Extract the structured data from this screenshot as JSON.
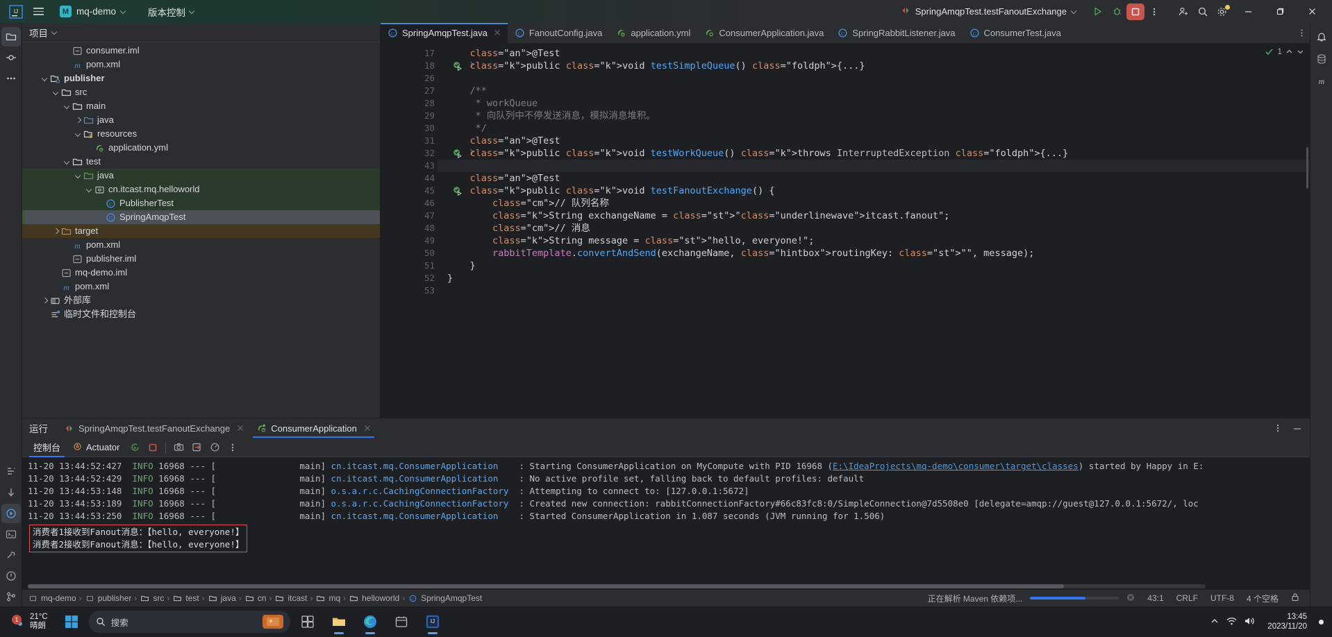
{
  "titlebar": {
    "menu_icon": "hamburger-menu-icon",
    "logo": "intellij-idea-logo",
    "project_badge": "M",
    "project_name": "mq-demo",
    "vcs_label": "版本控制",
    "run_config": "SpringAmqpTest.testFanoutExchange",
    "actions": [
      "run-button",
      "debug-button",
      "stop-button",
      "more-actions-button",
      "share-button",
      "search-everywhere-button",
      "settings-button"
    ],
    "window_controls": [
      "minimize",
      "maximize",
      "close"
    ]
  },
  "left_rail": {
    "items": [
      {
        "name": "project-tool-window",
        "icon": "folder-icon",
        "active": true
      },
      {
        "name": "commit-tool-window",
        "icon": "commit-icon",
        "active": false
      },
      {
        "name": "more-tool-windows",
        "icon": "ellipsis-icon",
        "active": false
      },
      {
        "name": "structure-tool-window",
        "icon": "structure-icon",
        "active": false
      },
      {
        "name": "bookmarks-tool-window",
        "icon": "arrow-down-icon",
        "active": false
      },
      {
        "name": "run-tool-window",
        "icon": "run-icon",
        "active": true
      },
      {
        "name": "terminal-tool-window",
        "icon": "terminal-icon",
        "active": false
      },
      {
        "name": "build-tool-window",
        "icon": "build-icon",
        "active": false
      },
      {
        "name": "problems-tool-window",
        "icon": "warning-icon",
        "active": false
      },
      {
        "name": "git-tool-window",
        "icon": "git-icon",
        "active": false
      }
    ]
  },
  "right_rail": {
    "items": [
      {
        "name": "notifications-tool-window",
        "icon": "bell-icon"
      },
      {
        "name": "database-tool-window",
        "icon": "database-icon"
      },
      {
        "name": "maven-tool-window",
        "icon": "maven-m-icon"
      }
    ]
  },
  "project_panel": {
    "title": "项目",
    "tree": [
      {
        "indent": 3,
        "arrow": "none",
        "icon": "iml-file-icon",
        "label": "consumer.iml",
        "bold": false,
        "state": "none"
      },
      {
        "indent": 3,
        "arrow": "none",
        "icon": "maven-m-icon",
        "label": "pom.xml",
        "bold": false,
        "state": "none"
      },
      {
        "indent": 1,
        "arrow": "down",
        "icon": "module-folder-icon",
        "label": "publisher",
        "bold": true,
        "state": "none"
      },
      {
        "indent": 2,
        "arrow": "down",
        "icon": "folder-icon",
        "label": "src",
        "bold": false,
        "state": "none"
      },
      {
        "indent": 3,
        "arrow": "down",
        "icon": "folder-icon",
        "label": "main",
        "bold": false,
        "state": "none"
      },
      {
        "indent": 4,
        "arrow": "right",
        "icon": "source-folder-icon",
        "label": "java",
        "bold": false,
        "state": "none"
      },
      {
        "indent": 4,
        "arrow": "down",
        "icon": "resource-folder-icon",
        "label": "resources",
        "bold": false,
        "state": "none"
      },
      {
        "indent": 5,
        "arrow": "none",
        "icon": "spring-yaml-icon",
        "label": "application.yml",
        "bold": false,
        "state": "none"
      },
      {
        "indent": 3,
        "arrow": "down",
        "icon": "folder-icon",
        "label": "test",
        "bold": false,
        "state": "none"
      },
      {
        "indent": 4,
        "arrow": "down",
        "icon": "test-source-folder-icon",
        "label": "java",
        "bold": false,
        "state": "green"
      },
      {
        "indent": 5,
        "arrow": "down",
        "icon": "package-icon",
        "label": "cn.itcast.mq.helloworld",
        "bold": false,
        "state": "green"
      },
      {
        "indent": 6,
        "arrow": "none",
        "icon": "java-class-icon",
        "label": "PublisherTest",
        "bold": false,
        "state": "green"
      },
      {
        "indent": 6,
        "arrow": "none",
        "icon": "java-class-icon",
        "label": "SpringAmqpTest",
        "bold": false,
        "state": "selected"
      },
      {
        "indent": 2,
        "arrow": "right",
        "icon": "excluded-folder-icon",
        "label": "target",
        "bold": false,
        "state": "brown"
      },
      {
        "indent": 3,
        "arrow": "none",
        "icon": "maven-m-icon",
        "label": "pom.xml",
        "bold": false,
        "state": "none"
      },
      {
        "indent": 3,
        "arrow": "none",
        "icon": "iml-file-icon",
        "label": "publisher.iml",
        "bold": false,
        "state": "none"
      },
      {
        "indent": 2,
        "arrow": "none",
        "icon": "iml-file-icon",
        "label": "mq-demo.iml",
        "bold": false,
        "state": "none"
      },
      {
        "indent": 2,
        "arrow": "none",
        "icon": "maven-m-icon",
        "label": "pom.xml",
        "bold": false,
        "state": "none"
      },
      {
        "indent": 1,
        "arrow": "right",
        "icon": "library-icon",
        "label": "外部库",
        "bold": false,
        "state": "none"
      },
      {
        "indent": 1,
        "arrow": "none",
        "icon": "scratches-icon",
        "label": "临时文件和控制台",
        "bold": false,
        "state": "none"
      }
    ]
  },
  "editor": {
    "tabs": [
      {
        "label": "SpringAmqpTest.java",
        "icon": "java-class-icon",
        "active": true,
        "closable": true
      },
      {
        "label": "FanoutConfig.java",
        "icon": "java-class-icon",
        "active": false,
        "closable": false
      },
      {
        "label": "application.yml",
        "icon": "spring-yaml-icon",
        "active": false,
        "closable": false
      },
      {
        "label": "ConsumerApplication.java",
        "icon": "spring-class-icon",
        "active": false,
        "closable": false
      },
      {
        "label": "SpringRabbitListener.java",
        "icon": "java-class-icon",
        "active": false,
        "closable": false
      },
      {
        "label": "ConsumerTest.java",
        "icon": "java-class-icon",
        "active": false,
        "closable": false
      }
    ],
    "inspection_count": "1",
    "lines": [
      {
        "num": "17",
        "gutter": "none",
        "fold": false,
        "highlight": false
      },
      {
        "num": "18",
        "gutter": "run-test",
        "fold": true,
        "highlight": false
      },
      {
        "num": "26",
        "gutter": "none",
        "fold": false,
        "highlight": false
      },
      {
        "num": "27",
        "gutter": "none",
        "fold": false,
        "highlight": false
      },
      {
        "num": "28",
        "gutter": "none",
        "fold": false,
        "highlight": false
      },
      {
        "num": "29",
        "gutter": "none",
        "fold": false,
        "highlight": false
      },
      {
        "num": "30",
        "gutter": "none",
        "fold": false,
        "highlight": false
      },
      {
        "num": "31",
        "gutter": "none",
        "fold": false,
        "highlight": false
      },
      {
        "num": "32",
        "gutter": "run-test",
        "fold": true,
        "highlight": false
      },
      {
        "num": "43",
        "gutter": "none",
        "fold": false,
        "highlight": true
      },
      {
        "num": "44",
        "gutter": "none",
        "fold": false,
        "highlight": false
      },
      {
        "num": "45",
        "gutter": "run-test",
        "fold": false,
        "highlight": false
      },
      {
        "num": "46",
        "gutter": "none",
        "fold": false,
        "highlight": false
      },
      {
        "num": "47",
        "gutter": "none",
        "fold": false,
        "highlight": false
      },
      {
        "num": "48",
        "gutter": "none",
        "fold": false,
        "highlight": false
      },
      {
        "num": "49",
        "gutter": "none",
        "fold": false,
        "highlight": false
      },
      {
        "num": "50",
        "gutter": "none",
        "fold": false,
        "highlight": false
      },
      {
        "num": "51",
        "gutter": "none",
        "fold": false,
        "highlight": false
      },
      {
        "num": "52",
        "gutter": "none",
        "fold": false,
        "highlight": false
      },
      {
        "num": "53",
        "gutter": "none",
        "fold": false,
        "highlight": false
      }
    ],
    "code_text": [
      "    @Test",
      "    public void testSimpleQueue() {...}",
      "",
      "    /**",
      "     * workQueue",
      "     * 向队列中不停发送消息，模拟消息堆积。",
      "     */",
      "    @Test",
      "    public void testWorkQueue() throws InterruptedException {...}",
      "",
      "    @Test",
      "    public void testFanoutExchange() {",
      "        // 队列名称",
      "        String exchangeName = \"itcast.fanout\";",
      "        // 消息",
      "        String message = \"hello, everyone!\";",
      "        rabbitTemplate.convertAndSend(exchangeName, routingKey: \"\", message);",
      "    }",
      "}",
      ""
    ],
    "inlay_hint": "routingKey:"
  },
  "bottom_window": {
    "title": "运行",
    "tabs": [
      {
        "label": "SpringAmqpTest.testFanoutExchange",
        "icon": "rerun-failed-icon",
        "active": false
      },
      {
        "label": "ConsumerApplication",
        "icon": "spring-boot-icon",
        "active": true
      }
    ],
    "subtabs": [
      {
        "label": "控制台",
        "active": true
      },
      {
        "label": "Actuator",
        "active": false,
        "icon": "actuator-icon"
      }
    ],
    "sub_actions": [
      "rerun-icon",
      "stop-icon",
      "camera-icon",
      "export-icon",
      "dashboard-icon",
      "more-icon"
    ],
    "head_actions": [
      "settings-icon",
      "minimize-icon"
    ],
    "console_lines": [
      {
        "time": "11-20 13:44:52:427",
        "level": "INFO",
        "pid": "16968",
        "dashes": "--- [",
        "thread": "main]",
        "logger": "cn.itcast.mq.ConsumerApplication",
        "sep": ": ",
        "message": "Starting ConsumerApplication on MyCompute with PID 16968 (",
        "link": "E:\\IdeaProjects\\mq-demo\\consumer\\target\\classes",
        "tail": ") started by Happy in E:"
      },
      {
        "time": "11-20 13:44:52:429",
        "level": "INFO",
        "pid": "16968",
        "dashes": "--- [",
        "thread": "main]",
        "logger": "cn.itcast.mq.ConsumerApplication",
        "sep": ": ",
        "message": "No active profile set, falling back to default profiles: default",
        "link": "",
        "tail": ""
      },
      {
        "time": "11-20 13:44:53:148",
        "level": "INFO",
        "pid": "16968",
        "dashes": "--- [",
        "thread": "main]",
        "logger": "o.s.a.r.c.CachingConnectionFactory",
        "sep": ": ",
        "message": "Attempting to connect to: [127.0.0.1:5672]",
        "link": "",
        "tail": ""
      },
      {
        "time": "11-20 13:44:53:189",
        "level": "INFO",
        "pid": "16968",
        "dashes": "--- [",
        "thread": "main]",
        "logger": "o.s.a.r.c.CachingConnectionFactory",
        "sep": ": ",
        "message": "Created new connection: rabbitConnectionFactory#66c83fc8:0/SimpleConnection@7d5508e0 [delegate=amqp://guest@127.0.0.1:5672/, loc",
        "link": "",
        "tail": ""
      },
      {
        "time": "11-20 13:44:53:250",
        "level": "INFO",
        "pid": "16968",
        "dashes": "--- [",
        "thread": "main]",
        "logger": "cn.itcast.mq.ConsumerApplication",
        "sep": ": ",
        "message": "Started ConsumerApplication in 1.087 seconds (JVM running for 1.506)",
        "link": "",
        "tail": ""
      }
    ],
    "highlighted_output": [
      "消费者1接收到Fanout消息：【hello, everyone!】",
      "消费者2接收到Fanout消息：【hello, everyone!】"
    ],
    "highlight_color": "#e05252"
  },
  "status_bar": {
    "breadcrumbs": [
      "mq-demo",
      "publisher",
      "src",
      "test",
      "java",
      "cn",
      "itcast",
      "mq",
      "helloworld",
      "SpringAmqpTest"
    ],
    "breadcrumb_icons": [
      "module-icon",
      "module-icon",
      "folder-icon",
      "folder-icon",
      "folder-icon",
      "folder-icon",
      "folder-icon",
      "folder-icon",
      "folder-icon",
      "java-class-icon"
    ],
    "progress_text": "正在解析 Maven 依赖项...",
    "progress_percent": 62,
    "caret_position": "43:1",
    "line_separator": "CRLF",
    "encoding": "UTF-8",
    "indent": "4 个空格",
    "cancel_icon": "cancel-icon"
  },
  "taskbar": {
    "weather_temp": "21°C",
    "weather_desc": "晴朗",
    "weather_badge": "1",
    "search_placeholder": "搜索",
    "apps": [
      {
        "name": "taskbar-start-button",
        "icon": "windows-logo",
        "running": false
      },
      {
        "name": "taskbar-widgets",
        "icon": "widgets-icon",
        "running": false
      },
      {
        "name": "taskbar-file-explorer",
        "icon": "folder-icon",
        "running": true
      },
      {
        "name": "taskbar-edge",
        "icon": "edge-icon",
        "running": true
      },
      {
        "name": "taskbar-store",
        "icon": "store-icon",
        "running": false
      },
      {
        "name": "taskbar-idea",
        "icon": "intellij-idea-logo",
        "running": true
      }
    ],
    "tray_icons": [
      "chevron-up-icon",
      "network-icon",
      "volume-icon"
    ],
    "clock_time": "13:45",
    "clock_date": "2023/11/20"
  }
}
